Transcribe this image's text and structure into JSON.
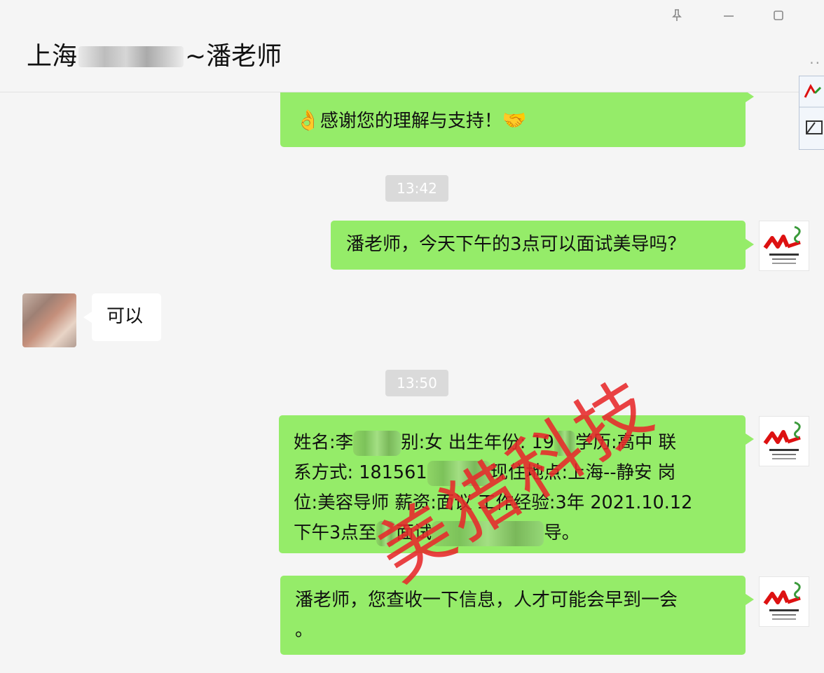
{
  "header": {
    "title_prefix": "上海",
    "title_suffix": "~潘老师",
    "pin_icon": "pin-icon",
    "minimize_icon": "minimize-icon",
    "maximize_icon": "maximize-icon",
    "more_icon": "more-icon"
  },
  "messages": [
    {
      "id": "m1",
      "side": "out",
      "text": "感谢您的理解与支持！"
    },
    {
      "id": "t1",
      "type": "time",
      "text": "13:42"
    },
    {
      "id": "m2",
      "side": "out",
      "text": "潘老师，今天下午的3点可以面试美导吗？"
    },
    {
      "id": "m3",
      "side": "in",
      "text": "可以"
    },
    {
      "id": "t2",
      "type": "time",
      "text": "13:50"
    },
    {
      "id": "m4",
      "side": "out",
      "line1a": "姓名:李",
      "line1b": "别:女 出生年份: 19",
      "line1c": "学历:高中 联",
      "line2a": "系方式: 181561",
      "line2b": "现住地点:上海--静安 岗",
      "line3": "位:美容导师 薪资:面议 工作经验:3年 2021.10.12",
      "line4a": "下午3点至",
      "line4b": "面试",
      "line4c": "导。"
    },
    {
      "id": "m5",
      "side": "out",
      "line1": "潘老师，您查收一下信息，人才可能会早到一会",
      "line2": "。"
    }
  ],
  "watermark": "美猎科技",
  "colors": {
    "bubble_out": "#95ec69",
    "bubble_in": "#ffffff",
    "watermark": "#e8292b",
    "time_bg": "#dadada"
  }
}
